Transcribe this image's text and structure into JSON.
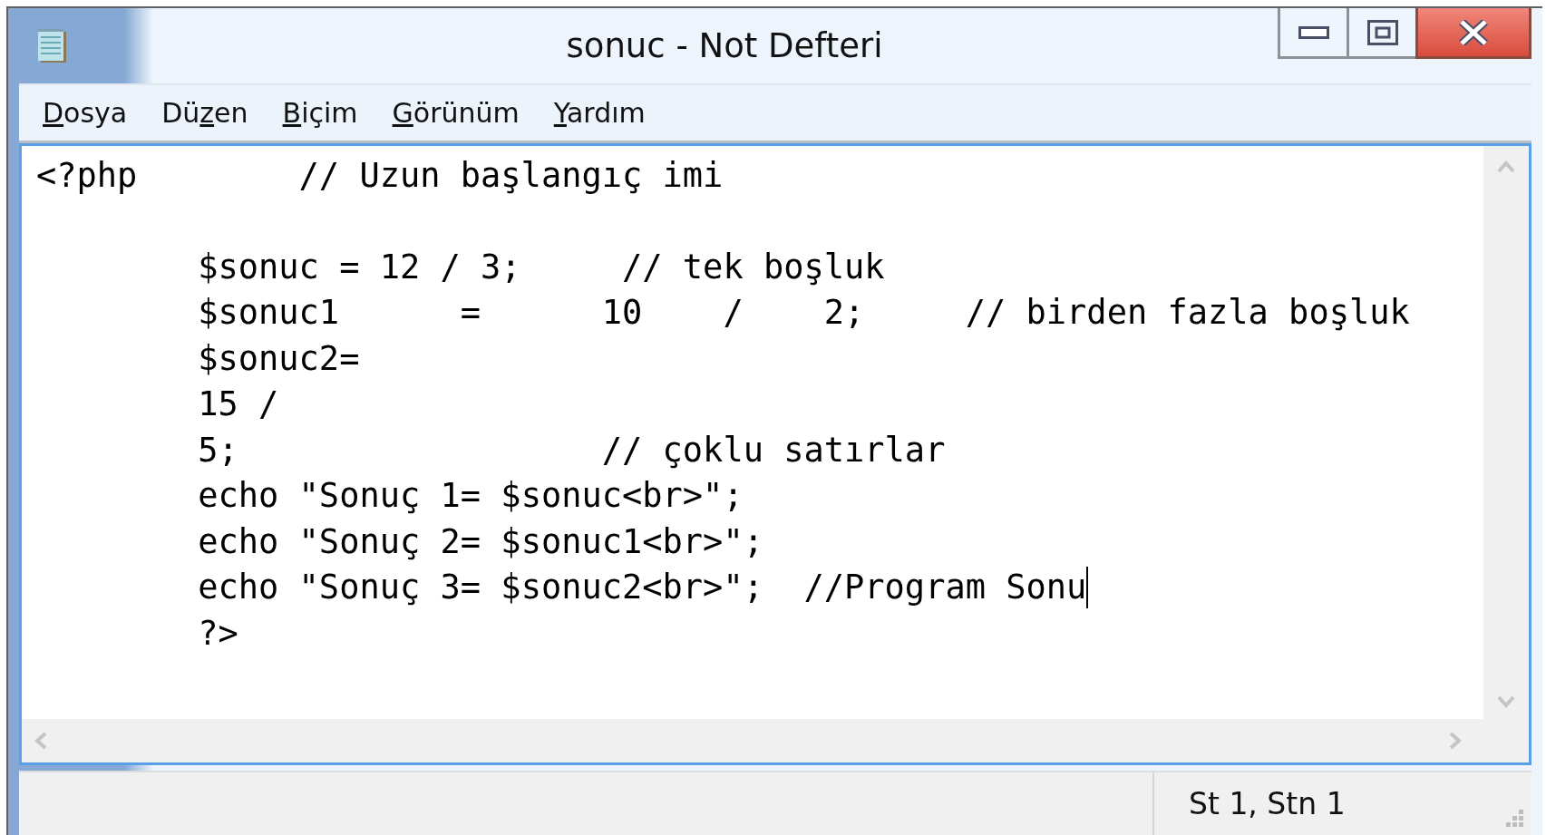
{
  "window": {
    "title": "sonuc - Not Defteri"
  },
  "menu": [
    {
      "key": "D",
      "after": "osya"
    },
    {
      "before": "Dü",
      "key": "z",
      "after": "en"
    },
    {
      "key": "B",
      "after": "içim"
    },
    {
      "key": "G",
      "after": "örünüm"
    },
    {
      "key": "Y",
      "after": "ardım"
    }
  ],
  "editor": {
    "lines": [
      {
        "kind": "code",
        "text": "<?php        // Uzun başlangıç imi",
        "caret": false
      },
      {
        "kind": "blank"
      },
      {
        "kind": "code",
        "text": "\t$sonuc = 12 / 3;     // tek boşluk",
        "caret": false
      },
      {
        "kind": "code",
        "text": "\t$sonuc1      =      10    /    2;     // birden fazla boşluk",
        "caret": false
      },
      {
        "kind": "code",
        "text": "\t$sonuc2=",
        "caret": false
      },
      {
        "kind": "code",
        "text": "\t15 /",
        "caret": false
      },
      {
        "kind": "code",
        "text": "\t5;                  // çoklu satırlar",
        "caret": false
      },
      {
        "kind": "code",
        "text": "\techo \"Sonuç 1= $sonuc<br>\";",
        "caret": false
      },
      {
        "kind": "code",
        "text": "\techo \"Sonuç 2= $sonuc1<br>\";",
        "caret": false
      },
      {
        "kind": "code",
        "text": "\techo \"Sonuç 3= $sonuc2<br>\";  //Program Sonu",
        "caret": true
      },
      {
        "kind": "code",
        "text": "\t?>",
        "caret": false
      }
    ]
  },
  "status_bar": {
    "position": "St 1, Stn 1"
  }
}
